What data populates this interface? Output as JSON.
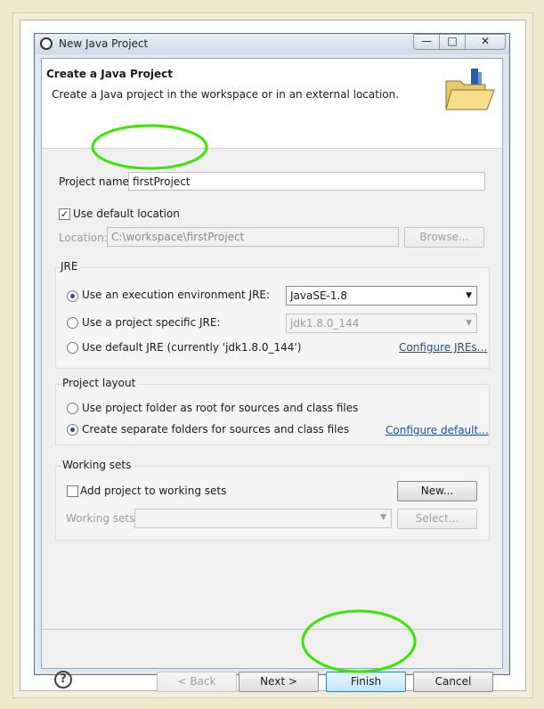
{
  "window": {
    "title": "New Java Project",
    "controls": {
      "minimize": "—",
      "maximize": "□",
      "close": "✕"
    }
  },
  "banner": {
    "title": "Create a Java Project",
    "description": "Create a Java project in the workspace or in an external location."
  },
  "project": {
    "name_label": "Project name:",
    "name_value": "firstProject",
    "use_default_location_label": "Use default location",
    "use_default_location_checked": true,
    "location_label": "Location:",
    "location_value": "C:\\workspace\\firstProject",
    "browse_label": "Browse..."
  },
  "jre": {
    "group_title": "JRE",
    "exec_env_label": "Use an execution environment JRE:",
    "exec_env_value": "JavaSE-1.8",
    "specific_label": "Use a project specific JRE:",
    "specific_value": "jdk1.8.0_144",
    "default_label": "Use default JRE (currently 'jdk1.8.0_144')",
    "configure_link": "Configure JREs...",
    "selected": "exec_env"
  },
  "layout": {
    "group_title": "Project layout",
    "option_root": "Use project folder as root for sources and class files",
    "option_separate": "Create separate folders for sources and class files",
    "configure_link": "Configure default...",
    "selected": "separate"
  },
  "working_sets": {
    "group_title": "Working sets",
    "add_label": "Add project to working sets",
    "new_button": "New...",
    "sets_label": "Working sets:",
    "select_button": "Select..."
  },
  "footer": {
    "help": "?",
    "back": "< Back",
    "next": "Next >",
    "finish": "Finish",
    "cancel": "Cancel"
  },
  "colors": {
    "annotation": "#39e600",
    "link": "#1f4e9a"
  }
}
